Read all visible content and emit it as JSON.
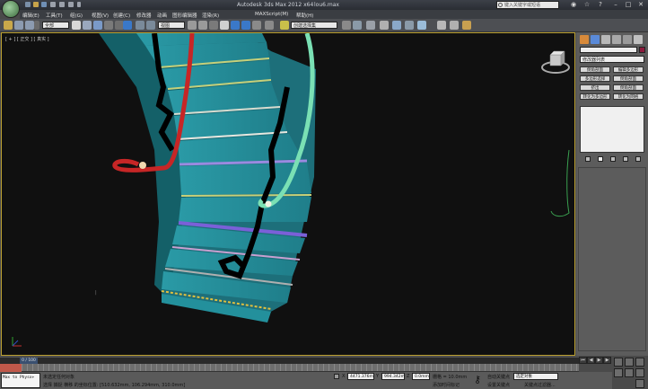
{
  "window": {
    "title": "Autodesk 3ds Max  2012 x64",
    "file": "lou6.max",
    "search_placeholder": "键入关键字或短语"
  },
  "menu": [
    "编辑(E)",
    "工具(T)",
    "组(G)",
    "视图(V)",
    "创建(C)",
    "修改器",
    "动画",
    "图形编辑器",
    "渲染(R)",
    "MAXScript(M)",
    "帮助(H)"
  ],
  "toolbar": {
    "selection_set": "全部",
    "view_set": "视图",
    "named_set": "创建选择集"
  },
  "viewport": {
    "label": "[ + ] [ 正交 ] [ 真实 ]"
  },
  "command_panel": {
    "modifier_list": "修改器列表",
    "buttons": [
      [
        "倒角剖面",
        "编辑多边形"
      ],
      [
        "多边形选择",
        "倒角剖面"
      ],
      [
        "挤出",
        "倒角剖面"
      ],
      [
        "转化为多边形",
        "转化为网格"
      ]
    ]
  },
  "timeline": {
    "frame": "0 / 100"
  },
  "status": {
    "maxscript": "Max to Physx+",
    "selection": "未选定任何对象",
    "prompt": "选择 捕捉 横移 的坐标位置: [510.632mm, 106.294mm, 310.0mm]",
    "x_value": "4471.376m",
    "y_value": "994.342m",
    "z_value": "0.0mm",
    "grid": "栅格 = 10.0mm",
    "add_time_tag": "添加时间标记",
    "auto_key": "自动关键点",
    "selected_mode": "选定对象",
    "set_key": "设置关键点",
    "key_filters": "关键点过滤器..."
  }
}
